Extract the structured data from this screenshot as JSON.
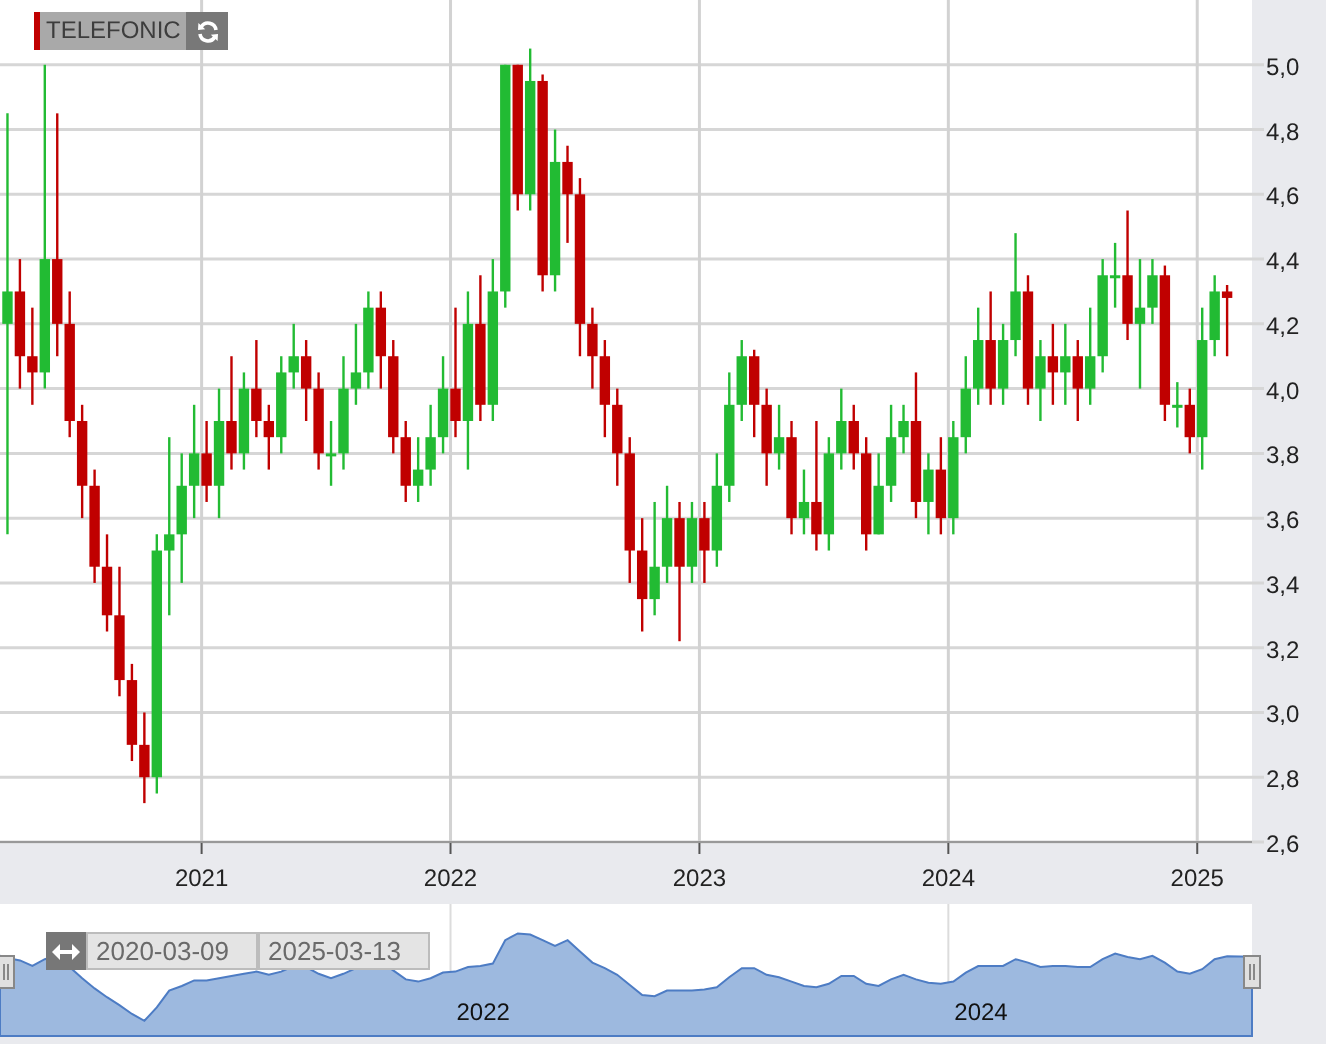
{
  "legend": {
    "label": "TELEFONIC",
    "color": "#c00000"
  },
  "chart": {
    "chart_data": {
      "type": "candlestick",
      "grid": true,
      "xlim": [
        2020.19,
        2025.22
      ],
      "ylim": [
        2.6,
        5.2
      ],
      "xticks": [
        {
          "value": 2021,
          "label": "2021"
        },
        {
          "value": 2022,
          "label": "2022"
        },
        {
          "value": 2023,
          "label": "2023"
        },
        {
          "value": 2024,
          "label": "2024"
        },
        {
          "value": 2025,
          "label": "2025"
        }
      ],
      "yticks": [
        {
          "value": 2.6,
          "label": "2,6"
        },
        {
          "value": 2.8,
          "label": "2,8"
        },
        {
          "value": 3.0,
          "label": "3,0"
        },
        {
          "value": 3.2,
          "label": "3,2"
        },
        {
          "value": 3.4,
          "label": "3,4"
        },
        {
          "value": 3.6,
          "label": "3,6"
        },
        {
          "value": 3.8,
          "label": "3,8"
        },
        {
          "value": 4.0,
          "label": "4,0"
        },
        {
          "value": 4.2,
          "label": "4,2"
        },
        {
          "value": 4.4,
          "label": "4,4"
        },
        {
          "value": 4.6,
          "label": "4,6"
        },
        {
          "value": 4.8,
          "label": "4,8"
        },
        {
          "value": 5.0,
          "label": "5,0"
        }
      ],
      "x": [
        2020.22,
        2020.27,
        2020.32,
        2020.37,
        2020.42,
        2020.47,
        2020.52,
        2020.57,
        2020.62,
        2020.67,
        2020.72,
        2020.77,
        2020.82,
        2020.87,
        2020.92,
        2020.97,
        2021.02,
        2021.07,
        2021.12,
        2021.17,
        2021.22,
        2021.27,
        2021.32,
        2021.37,
        2021.42,
        2021.47,
        2021.52,
        2021.57,
        2021.62,
        2021.67,
        2021.72,
        2021.77,
        2021.82,
        2021.87,
        2021.92,
        2021.97,
        2022.02,
        2022.07,
        2022.12,
        2022.17,
        2022.22,
        2022.27,
        2022.32,
        2022.37,
        2022.42,
        2022.47,
        2022.52,
        2022.57,
        2022.62,
        2022.67,
        2022.72,
        2022.77,
        2022.82,
        2022.87,
        2022.92,
        2022.97,
        2023.02,
        2023.07,
        2023.12,
        2023.17,
        2023.22,
        2023.27,
        2023.32,
        2023.37,
        2023.42,
        2023.47,
        2023.52,
        2023.57,
        2023.62,
        2023.67,
        2023.72,
        2023.77,
        2023.82,
        2023.87,
        2023.92,
        2023.97,
        2024.02,
        2024.07,
        2024.12,
        2024.17,
        2024.22,
        2024.27,
        2024.32,
        2024.37,
        2024.42,
        2024.47,
        2024.52,
        2024.57,
        2024.62,
        2024.67,
        2024.72,
        2024.77,
        2024.82,
        2024.87,
        2024.92,
        2024.97,
        2025.02,
        2025.07,
        2025.12
      ],
      "ohlc": [
        [
          4.2,
          4.85,
          3.55,
          4.3
        ],
        [
          4.3,
          4.4,
          4.0,
          4.1
        ],
        [
          4.1,
          4.25,
          3.95,
          4.05
        ],
        [
          4.05,
          5.0,
          4.0,
          4.4
        ],
        [
          4.4,
          4.85,
          4.1,
          4.2
        ],
        [
          4.2,
          4.3,
          3.85,
          3.9
        ],
        [
          3.9,
          3.95,
          3.6,
          3.7
        ],
        [
          3.7,
          3.75,
          3.4,
          3.45
        ],
        [
          3.45,
          3.55,
          3.25,
          3.3
        ],
        [
          3.3,
          3.45,
          3.05,
          3.1
        ],
        [
          3.1,
          3.15,
          2.85,
          2.9
        ],
        [
          2.9,
          3.0,
          2.72,
          2.8
        ],
        [
          2.8,
          3.55,
          2.75,
          3.5
        ],
        [
          3.5,
          3.85,
          3.3,
          3.55
        ],
        [
          3.55,
          3.8,
          3.4,
          3.7
        ],
        [
          3.7,
          3.95,
          3.6,
          3.8
        ],
        [
          3.8,
          3.9,
          3.65,
          3.7
        ],
        [
          3.7,
          4.0,
          3.6,
          3.9
        ],
        [
          3.9,
          4.1,
          3.75,
          3.8
        ],
        [
          3.8,
          4.05,
          3.75,
          4.0
        ],
        [
          4.0,
          4.15,
          3.85,
          3.9
        ],
        [
          3.9,
          3.95,
          3.75,
          3.85
        ],
        [
          3.85,
          4.1,
          3.8,
          4.05
        ],
        [
          4.05,
          4.2,
          4.0,
          4.1
        ],
        [
          4.1,
          4.15,
          3.9,
          4.0
        ],
        [
          4.0,
          4.05,
          3.75,
          3.8
        ],
        [
          3.8,
          3.9,
          3.7,
          3.8
        ],
        [
          3.8,
          4.1,
          3.75,
          4.0
        ],
        [
          4.0,
          4.2,
          3.95,
          4.05
        ],
        [
          4.05,
          4.3,
          4.0,
          4.25
        ],
        [
          4.25,
          4.3,
          4.0,
          4.1
        ],
        [
          4.1,
          4.15,
          3.8,
          3.85
        ],
        [
          3.85,
          3.9,
          3.65,
          3.7
        ],
        [
          3.7,
          3.85,
          3.65,
          3.75
        ],
        [
          3.75,
          3.95,
          3.7,
          3.85
        ],
        [
          3.85,
          4.1,
          3.8,
          4.0
        ],
        [
          4.0,
          4.25,
          3.85,
          3.9
        ],
        [
          3.9,
          4.3,
          3.75,
          4.2
        ],
        [
          4.2,
          4.35,
          3.9,
          3.95
        ],
        [
          3.95,
          4.4,
          3.9,
          4.3
        ],
        [
          4.3,
          5.0,
          4.25,
          5.0
        ],
        [
          5.0,
          5.0,
          4.55,
          4.6
        ],
        [
          4.6,
          5.05,
          4.55,
          4.95
        ],
        [
          4.95,
          4.97,
          4.3,
          4.35
        ],
        [
          4.35,
          4.8,
          4.3,
          4.7
        ],
        [
          4.7,
          4.75,
          4.45,
          4.6
        ],
        [
          4.6,
          4.65,
          4.1,
          4.2
        ],
        [
          4.2,
          4.25,
          4.0,
          4.1
        ],
        [
          4.1,
          4.15,
          3.85,
          3.95
        ],
        [
          3.95,
          4.0,
          3.7,
          3.8
        ],
        [
          3.8,
          3.85,
          3.4,
          3.5
        ],
        [
          3.5,
          3.6,
          3.25,
          3.35
        ],
        [
          3.35,
          3.65,
          3.3,
          3.45
        ],
        [
          3.45,
          3.7,
          3.4,
          3.6
        ],
        [
          3.6,
          3.65,
          3.22,
          3.45
        ],
        [
          3.45,
          3.65,
          3.4,
          3.6
        ],
        [
          3.6,
          3.65,
          3.4,
          3.5
        ],
        [
          3.5,
          3.8,
          3.45,
          3.7
        ],
        [
          3.7,
          4.05,
          3.65,
          3.95
        ],
        [
          3.95,
          4.15,
          3.9,
          4.1
        ],
        [
          4.1,
          4.12,
          3.85,
          3.95
        ],
        [
          3.95,
          4.0,
          3.7,
          3.8
        ],
        [
          3.8,
          3.95,
          3.75,
          3.85
        ],
        [
          3.85,
          3.9,
          3.55,
          3.6
        ],
        [
          3.6,
          3.75,
          3.55,
          3.65
        ],
        [
          3.65,
          3.9,
          3.5,
          3.55
        ],
        [
          3.55,
          3.85,
          3.5,
          3.8
        ],
        [
          3.8,
          4.0,
          3.75,
          3.9
        ],
        [
          3.9,
          3.95,
          3.75,
          3.8
        ],
        [
          3.8,
          3.85,
          3.5,
          3.55
        ],
        [
          3.55,
          3.8,
          3.55,
          3.7
        ],
        [
          3.7,
          3.95,
          3.65,
          3.85
        ],
        [
          3.85,
          3.95,
          3.8,
          3.9
        ],
        [
          3.9,
          4.05,
          3.6,
          3.65
        ],
        [
          3.65,
          3.8,
          3.55,
          3.75
        ],
        [
          3.75,
          3.85,
          3.55,
          3.6
        ],
        [
          3.6,
          3.9,
          3.55,
          3.85
        ],
        [
          3.85,
          4.1,
          3.8,
          4.0
        ],
        [
          4.0,
          4.25,
          3.95,
          4.15
        ],
        [
          4.15,
          4.3,
          3.95,
          4.0
        ],
        [
          4.0,
          4.2,
          3.95,
          4.15
        ],
        [
          4.15,
          4.48,
          4.1,
          4.3
        ],
        [
          4.3,
          4.35,
          3.95,
          4.0
        ],
        [
          4.0,
          4.15,
          3.9,
          4.1
        ],
        [
          4.1,
          4.2,
          3.95,
          4.05
        ],
        [
          4.05,
          4.2,
          3.95,
          4.1
        ],
        [
          4.1,
          4.15,
          3.9,
          4.0
        ],
        [
          4.0,
          4.25,
          3.95,
          4.1
        ],
        [
          4.1,
          4.4,
          4.05,
          4.35
        ],
        [
          4.35,
          4.45,
          4.25,
          4.35
        ],
        [
          4.35,
          4.55,
          4.15,
          4.2
        ],
        [
          4.2,
          4.4,
          4.0,
          4.25
        ],
        [
          4.25,
          4.4,
          4.2,
          4.35
        ],
        [
          4.35,
          4.38,
          3.9,
          3.95
        ],
        [
          3.95,
          4.02,
          3.88,
          3.95
        ],
        [
          3.95,
          4.0,
          3.8,
          3.85
        ],
        [
          3.85,
          4.25,
          3.75,
          4.15
        ],
        [
          4.15,
          4.35,
          4.1,
          4.3
        ],
        [
          4.3,
          4.32,
          4.1,
          4.28
        ]
      ]
    }
  },
  "navigator": {
    "labels": [
      {
        "label": "2022"
      },
      {
        "label": "2024"
      }
    ],
    "from": "2020-03-09",
    "to": "2025-03-13"
  }
}
